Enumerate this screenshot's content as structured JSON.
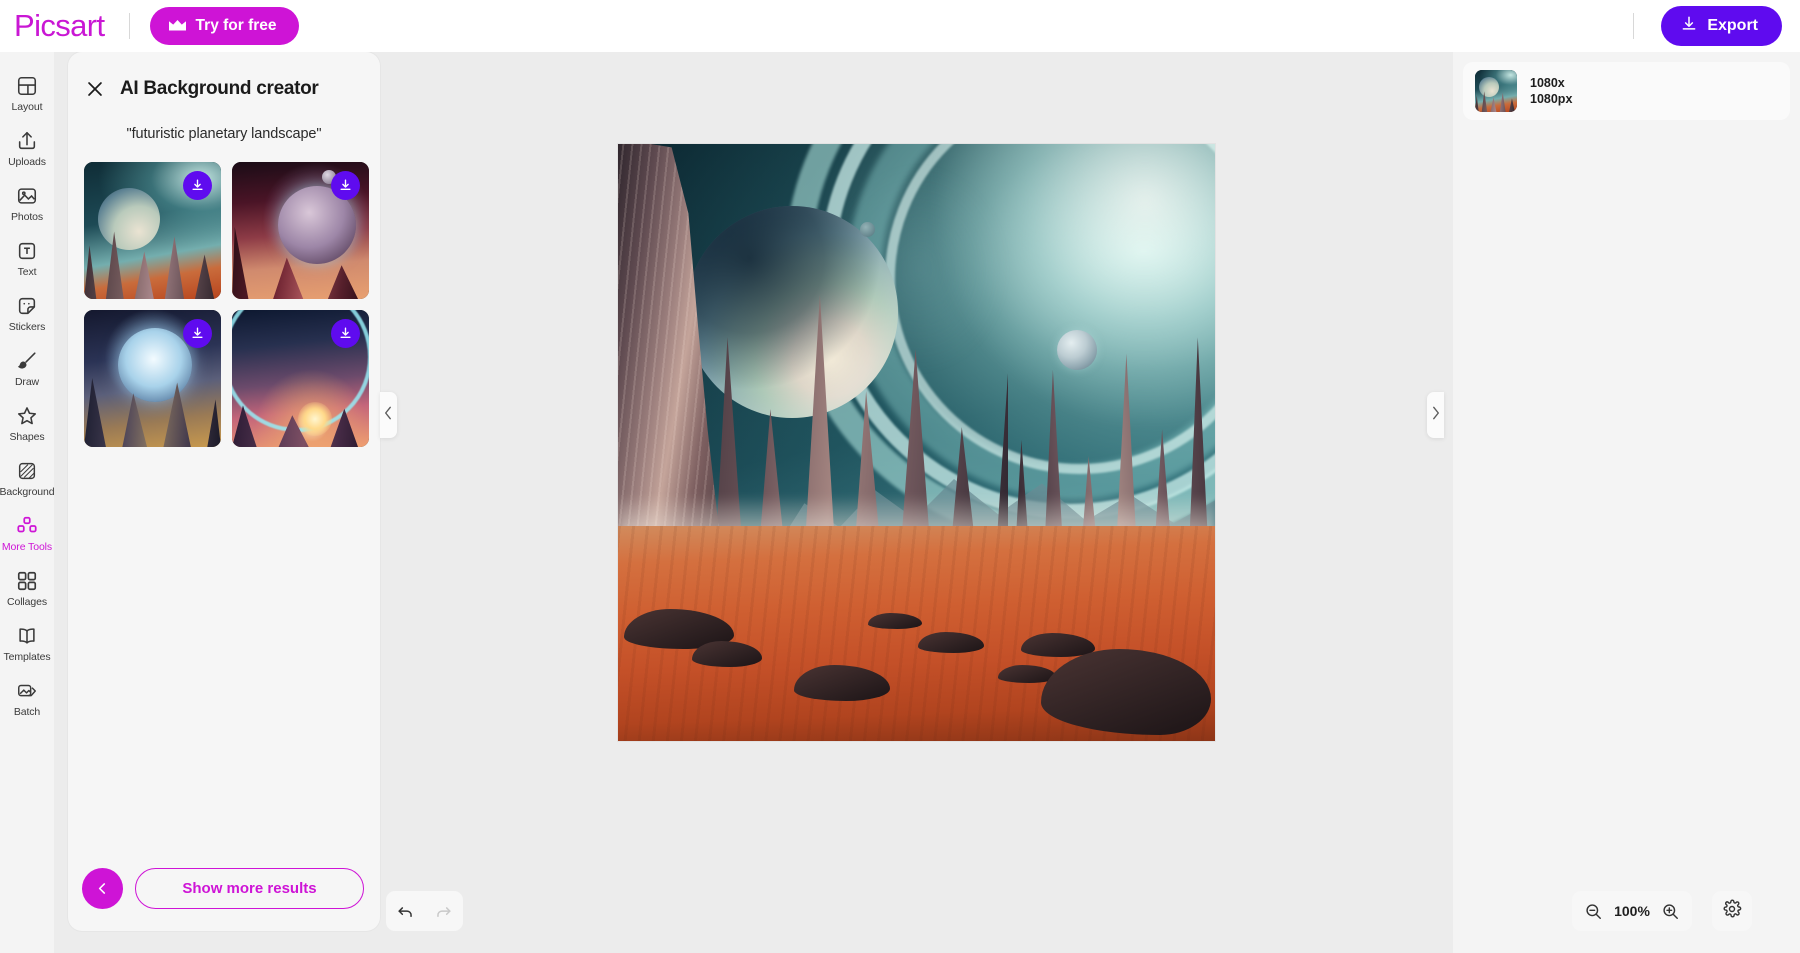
{
  "topbar": {
    "logo_text": "Picsart",
    "try_label": "Try for free",
    "export_label": "Export",
    "accent_magenta": "#CE14D6",
    "accent_violet": "#5F0BEF"
  },
  "sidebar": {
    "items": [
      {
        "label": "Layout",
        "icon": "layout-icon",
        "active": false
      },
      {
        "label": "Uploads",
        "icon": "upload-icon",
        "active": false
      },
      {
        "label": "Photos",
        "icon": "photo-icon",
        "active": false
      },
      {
        "label": "Text",
        "icon": "text-icon",
        "active": false
      },
      {
        "label": "Stickers",
        "icon": "sticker-icon",
        "active": false
      },
      {
        "label": "Draw",
        "icon": "brush-icon",
        "active": false
      },
      {
        "label": "Shapes",
        "icon": "star-icon",
        "active": false
      },
      {
        "label": "Background",
        "icon": "background-icon",
        "active": false
      },
      {
        "label": "More Tools",
        "icon": "more-tools-icon",
        "active": true
      },
      {
        "label": "Collages",
        "icon": "collage-icon",
        "active": false
      },
      {
        "label": "Templates",
        "icon": "template-icon",
        "active": false
      },
      {
        "label": "Batch",
        "icon": "batch-icon",
        "active": false
      }
    ]
  },
  "panel": {
    "title": "AI Background creator",
    "close_icon": "close-icon",
    "prompt": "\"futuristic planetary landscape\"",
    "results": [
      {
        "id": "result-1",
        "alt": "planetary landscape with rings and spires",
        "download": true
      },
      {
        "id": "result-2",
        "alt": "red cliff planet with moons",
        "download": true
      },
      {
        "id": "result-3",
        "alt": "blue canyon with glowing planet",
        "download": true
      },
      {
        "id": "result-4",
        "alt": "purple sunset desert with arc",
        "download": true
      }
    ],
    "back_label": "Back",
    "show_more_label": "Show more results"
  },
  "handles": {
    "left_icon": "chevron-left-icon",
    "right_icon": "chevron-right-icon"
  },
  "canvas": {
    "artwork_alt": "futuristic planetary landscape with ringed planet and rock spires"
  },
  "layers": {
    "items": [
      {
        "dimensions_line1": "1080x",
        "dimensions_line2": "1080px"
      }
    ]
  },
  "bottombar": {
    "undo_icon": "undo-icon",
    "redo_icon": "redo-icon",
    "zoom_out_icon": "zoom-out-icon",
    "zoom_in_icon": "zoom-in-icon",
    "zoom_level": "100%",
    "settings_icon": "gear-icon"
  }
}
